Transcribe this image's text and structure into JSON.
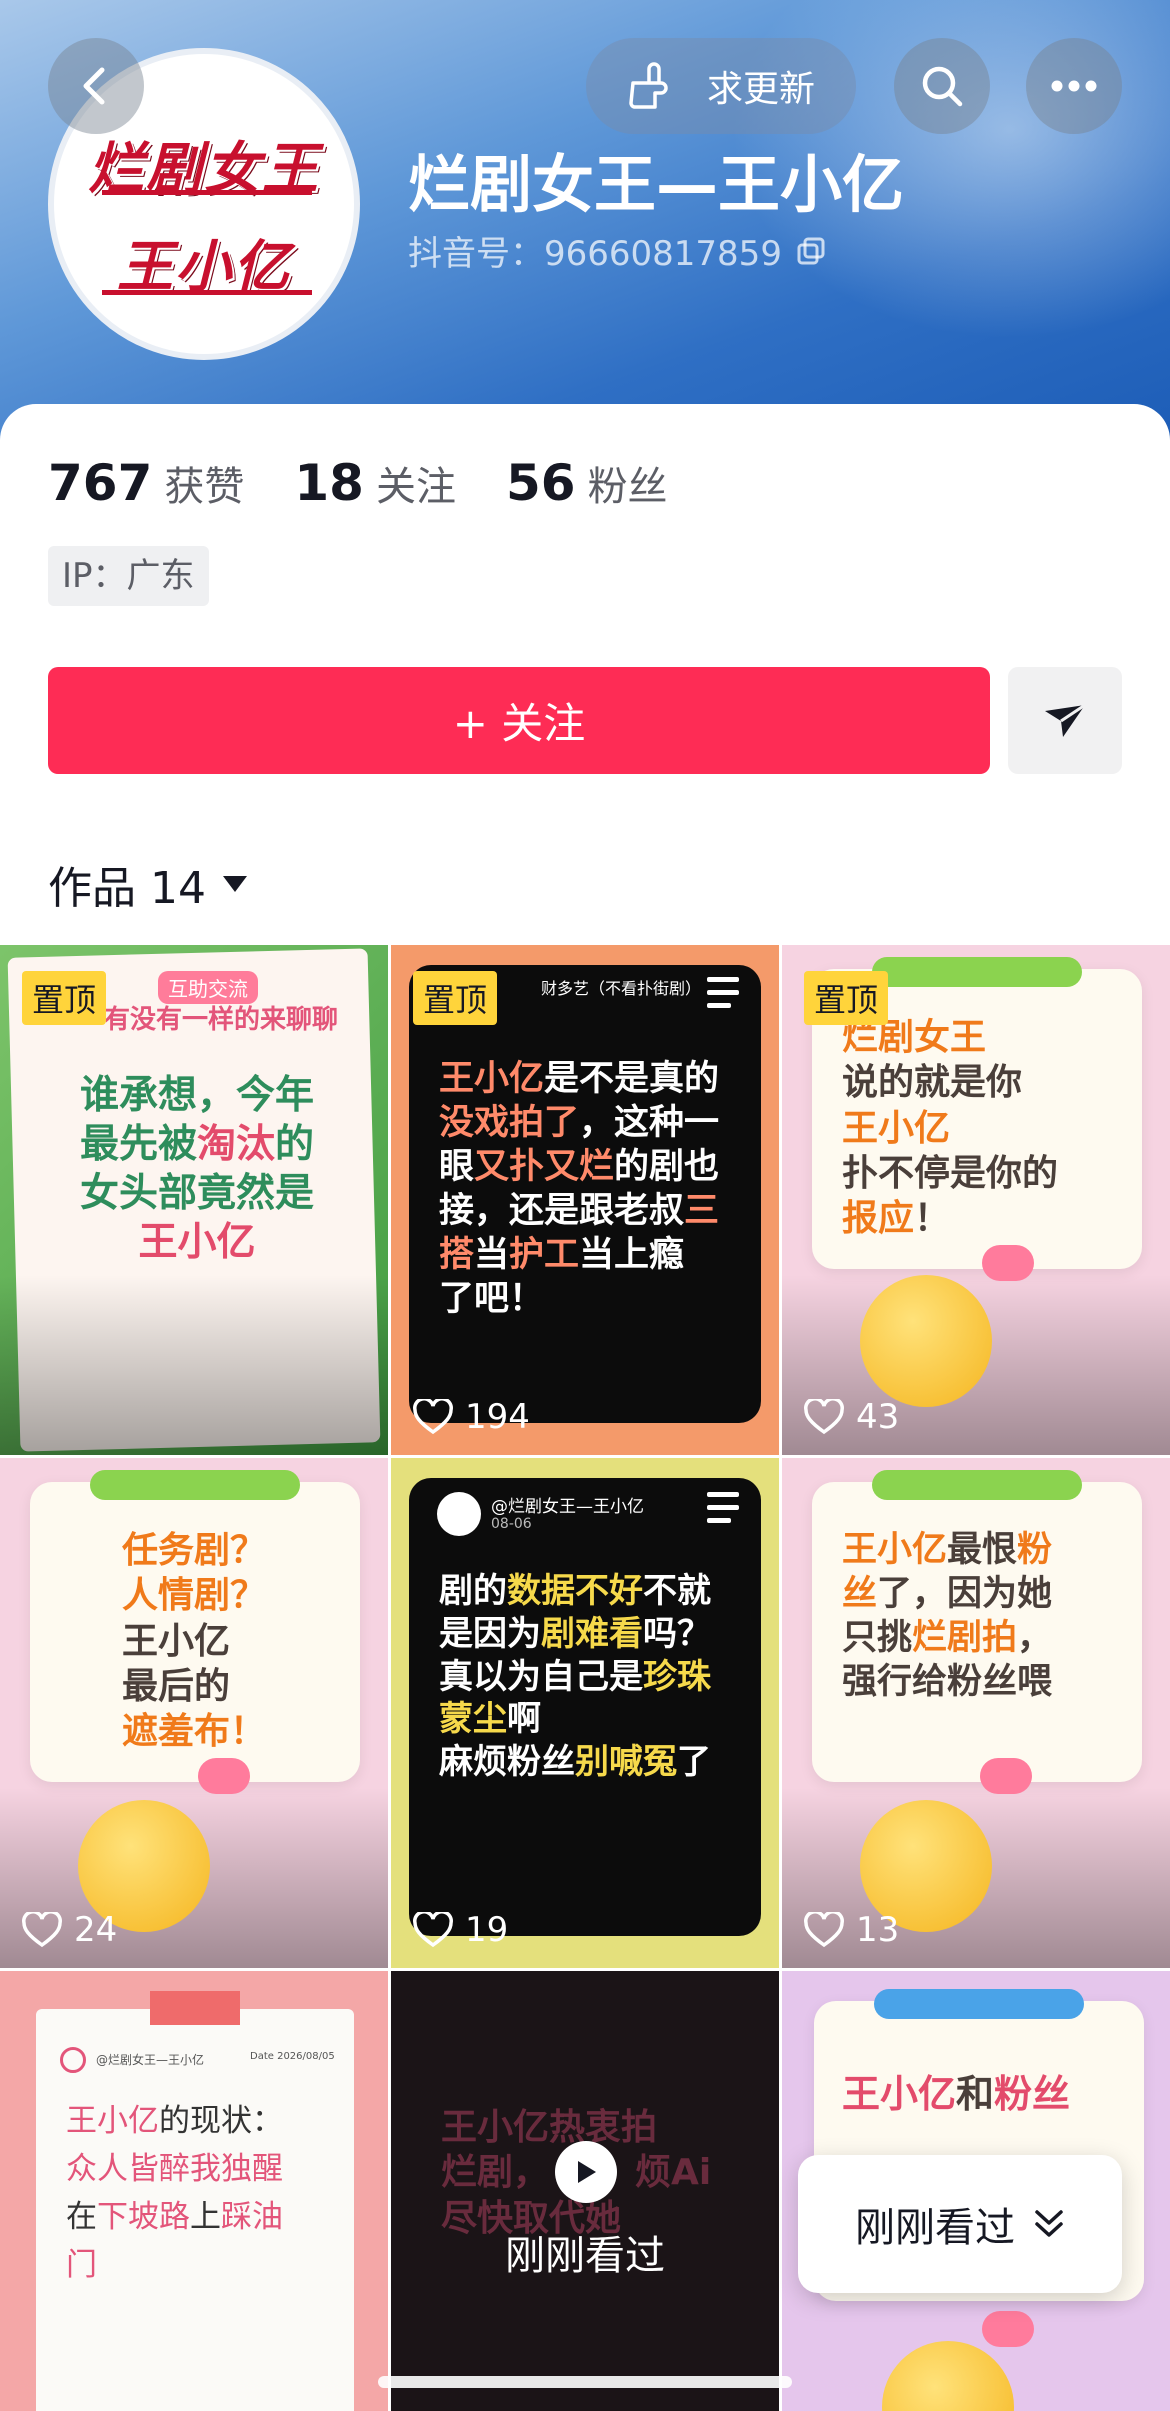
{
  "header": {
    "update_label": "求更新",
    "profile_name": "烂剧女王—王小亿",
    "douyin_id": "抖音号：96660817859",
    "avatar_line1": "烂剧女王",
    "avatar_line2": "王小亿"
  },
  "stats": [
    {
      "value": "767",
      "label": "获赞"
    },
    {
      "value": "18",
      "label": "关注"
    },
    {
      "value": "56",
      "label": "粉丝"
    }
  ],
  "ip_location": "IP：广东",
  "follow_label": "+ 关注",
  "works_tab": {
    "label": "作品 14"
  },
  "pinned_label": "置顶",
  "videos": [
    {
      "likes": "",
      "pinned": true
    },
    {
      "likes": "194",
      "pinned": true
    },
    {
      "likes": "43",
      "pinned": true
    },
    {
      "likes": "24",
      "pinned": false
    },
    {
      "likes": "19",
      "pinned": false
    },
    {
      "likes": "13",
      "pinned": false
    },
    {
      "likes": "",
      "pinned": false
    },
    {
      "likes": "",
      "pinned": false
    },
    {
      "likes": "",
      "pinned": false
    }
  ],
  "thumb_text": {
    "t1_badge": "互助交流",
    "t1_head": "有没有一样的来聊聊",
    "t1_line1": "谁承想，今年",
    "t1_line2a": "最先被",
    "t1_line2b": "淘汰",
    "t1_line2c": "的",
    "t1_line3": "女头部竟然是",
    "t1_line4": "王小亿",
    "t2_head": "财多艺（不看扑街剧）",
    "t2_a": "王小亿",
    "t2_b": "是不是真的",
    "t2_c": "没戏拍了",
    "t2_d": "，这种一",
    "t2_e": "眼",
    "t2_f": "又扑又烂",
    "t2_g": "的剧也",
    "t2_h": "接，还是跟老叔",
    "t2_i": "三",
    "t2_j": "搭",
    "t2_k": "当",
    "t2_l": "护工",
    "t2_m": "当上瘾",
    "t2_n": "了吧！",
    "t3_a": "烂剧女王",
    "t3_b": "说的就是你",
    "t3_c": "王小亿",
    "t3_d": "扑不停是你的",
    "t3_e": "报应",
    "t3_f": "！",
    "t4_a": "任务剧？",
    "t4_b": "人情剧？",
    "t4_c": "王小亿",
    "t4_d": "最后的",
    "t4_e": "遮羞布！",
    "t5_head": "@烂剧女王—王小亿",
    "t5_date": "08-06",
    "t5_a": "剧的",
    "t5_b": "数据不好",
    "t5_c": "不就",
    "t5_d": "是因为",
    "t5_e": "剧难看",
    "t5_f": "吗？",
    "t5_g": "真以为自己是",
    "t5_h": "珍珠",
    "t5_i": "蒙尘",
    "t5_j": "啊",
    "t5_k": "麻烦粉丝",
    "t5_l": "别喊冤",
    "t5_m": "了",
    "t6_a": "王小亿",
    "t6_b": "最恨",
    "t6_c": "粉",
    "t6_d": "丝",
    "t6_e": "了，因为她",
    "t6_f": "只挑",
    "t6_g": "烂剧拍",
    "t6_h": "，",
    "t6_i": "强行给粉丝喂",
    "t7_head": "@烂剧女王—王小亿",
    "t7_date": "Date 2026/08/05",
    "t7_a": "王小亿",
    "t7_b": "的现状：",
    "t7_c": "众人皆醉我独醒",
    "t7_d": "在",
    "t7_e": "下坡路",
    "t7_f": "上",
    "t7_g": "踩油",
    "t7_h": "门",
    "t8_a": "王小亿热衷拍",
    "t8_b": "烂剧，",
    "t8_c": "烦Ai",
    "t8_d": "尽快取代她",
    "t8_watched": "刚刚看过",
    "t9_a": "王小亿",
    "t9_b": "和",
    "t9_c": "粉丝"
  },
  "recent_pill": {
    "label": "刚刚看过"
  },
  "colors": {
    "accent": "#fe2c55",
    "pin": "#ffd43b",
    "hero": "#2f6fc4"
  }
}
